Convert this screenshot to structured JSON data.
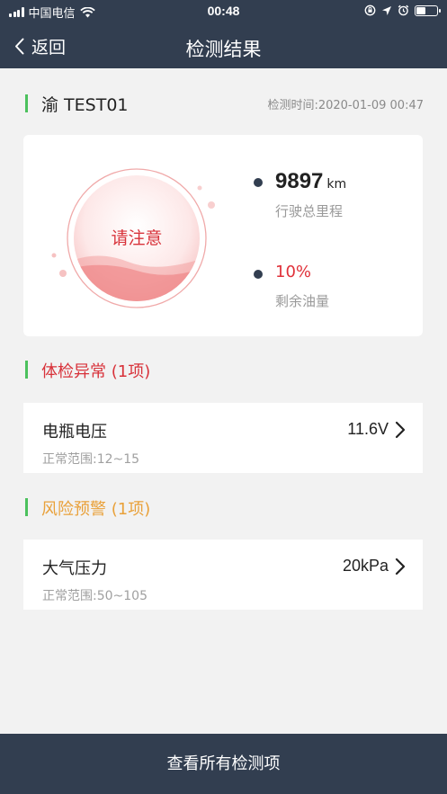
{
  "status_bar": {
    "carrier": "中国电信",
    "time": "00:48",
    "battery_level": 0.45,
    "icons": [
      "signal-icon",
      "wifi-icon",
      "rotation-lock-icon",
      "location-icon",
      "alarm-icon",
      "battery-icon"
    ]
  },
  "nav": {
    "back_label": "返回",
    "title": "检测结果"
  },
  "vehicle": {
    "plate": "渝 TEST01",
    "check_time": "检测时间:2020-01-09 00:47"
  },
  "summary": {
    "status_text": "请注意",
    "mileage_value": "9897",
    "mileage_unit": "km",
    "mileage_label": "行驶总里程",
    "fuel_value": "10%",
    "fuel_label": "剩余油量"
  },
  "sections": {
    "abnormal_title": "体检异常 (1项)",
    "risk_title": "风险预警 (1项)"
  },
  "items": {
    "battery": {
      "name": "电瓶电压",
      "value": "11.6V",
      "range": "正常范围:12~15"
    },
    "pressure": {
      "name": "大气压力",
      "value": "20kPa",
      "range": "正常范围:50~105"
    }
  },
  "footer": {
    "view_all_label": "查看所有检测项"
  },
  "colors": {
    "header_bg": "#323e50",
    "accent_green": "#4cc15d",
    "warning_red": "#d8323a",
    "risk_orange": "#e9a13a"
  }
}
